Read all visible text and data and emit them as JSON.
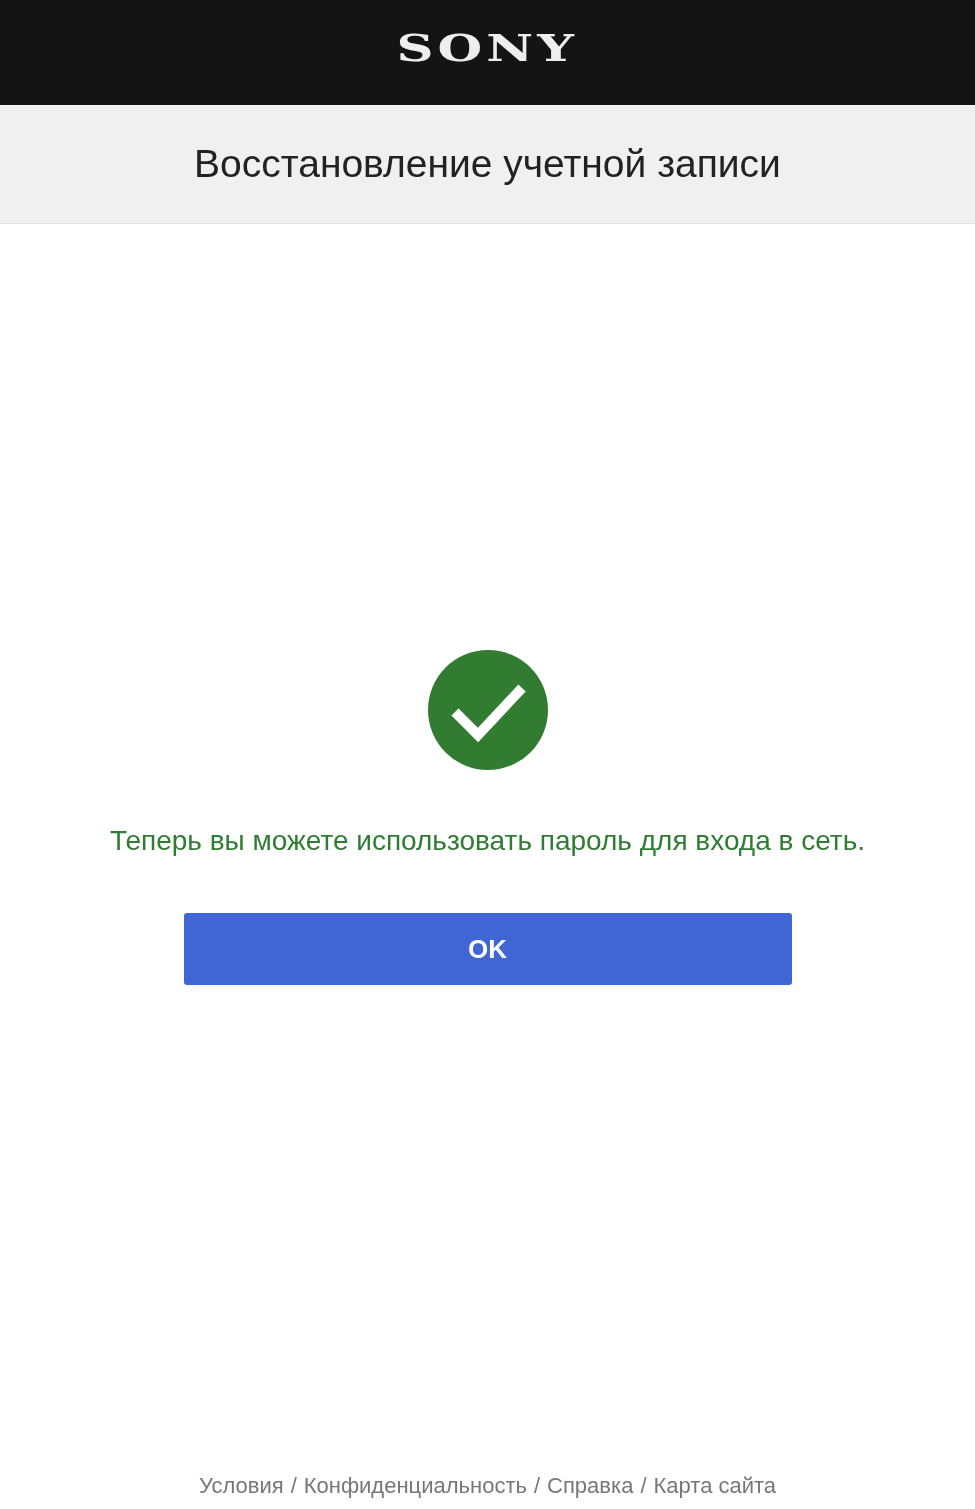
{
  "header": {
    "logo": "SONY"
  },
  "title": "Восстановление учетной записи",
  "message": "Теперь вы можете использовать пароль для входа в сеть.",
  "button": "OK",
  "footer": {
    "separator": "/",
    "links": [
      "Условия",
      "Конфиденциальность",
      "Справка",
      "Карта сайта"
    ]
  }
}
